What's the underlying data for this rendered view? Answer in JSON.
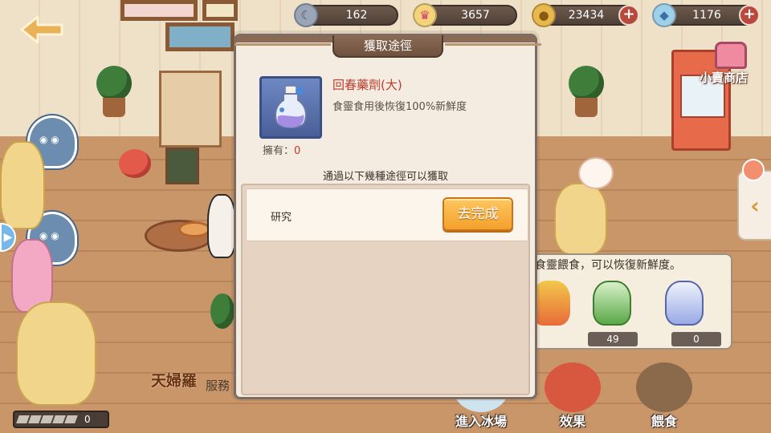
{
  "hud": {
    "currencies": [
      {
        "icon": "moon-coin-icon",
        "value": "162"
      },
      {
        "icon": "crown-icon",
        "value": "3657"
      },
      {
        "icon": "gold-coin-icon",
        "value": "23434"
      },
      {
        "icon": "crystal-icon",
        "value": "1176"
      }
    ],
    "shop_label": "小賣商店"
  },
  "modal": {
    "title": "獲取途徑",
    "item": {
      "name": "回春藥劑(大)",
      "description": "食靈食用後恢復100%新鮮度",
      "owned_label": "擁有：",
      "owned_value": "0"
    },
    "sources_title": "通過以下幾種途徑可以獲取",
    "sources": [
      {
        "name": "研究",
        "action_label": "去完成"
      }
    ]
  },
  "background": {
    "feed_hint": "食靈餵食，可以恢復新鮮度。",
    "feed_counts": [
      "49",
      "0"
    ],
    "character_name": "天婦羅",
    "character_duty": "服務",
    "stamina_value": "0",
    "bottom_buttons": [
      {
        "label": "進入冰場"
      },
      {
        "label": "效果"
      },
      {
        "label": "餵食"
      }
    ]
  },
  "colors": {
    "accent_orange": "#f3a12c",
    "item_name_red": "#c0392b",
    "modal_bg": "#f4ebe1",
    "header_brown": "#6e523f"
  }
}
